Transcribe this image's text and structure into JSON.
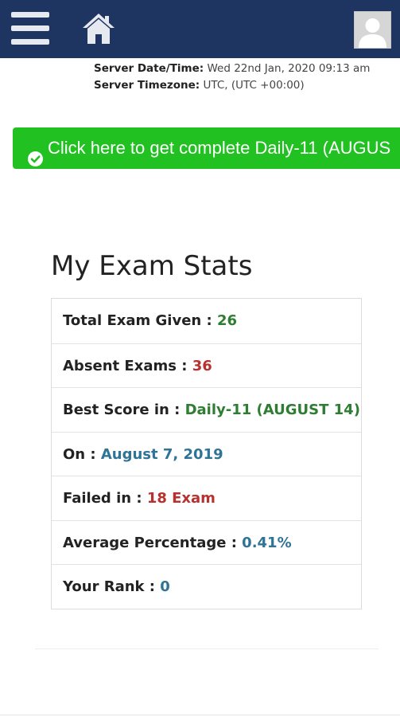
{
  "navbar": {
    "menu_icon": "hamburger-menu-icon",
    "home_icon": "home-icon",
    "avatar_icon": "user-avatar-icon",
    "background": "#1e3461"
  },
  "server": {
    "datetime_label": "Server Date/Time:",
    "datetime_value": "Wed 22nd Jan, 2020 09:13 am",
    "timezone_label": "Server Timezone:",
    "timezone_value": "UTC, (UTC +00:00)"
  },
  "banner": {
    "icon": "check-circle-icon",
    "text": "Click here to get complete Daily-11 (AUGUS",
    "color": "#22c122"
  },
  "stats": {
    "title": "My Exam Stats",
    "rows": [
      {
        "label": "Total Exam Given : ",
        "value": "26",
        "color": "green"
      },
      {
        "label": "Absent Exams : ",
        "value": "36",
        "color": "red"
      },
      {
        "label": "Best Score in : ",
        "value": "Daily-11 (AUGUST 14)",
        "color": "green"
      },
      {
        "label": "On : ",
        "value": "August 7, 2019",
        "color": "blue"
      },
      {
        "label": "Failed in : ",
        "value": "18 Exam",
        "color": "red"
      },
      {
        "label": "Average Percentage : ",
        "value": "0.41%",
        "color": "blue"
      },
      {
        "label": "Your Rank : ",
        "value": "0",
        "color": "blue"
      }
    ]
  }
}
